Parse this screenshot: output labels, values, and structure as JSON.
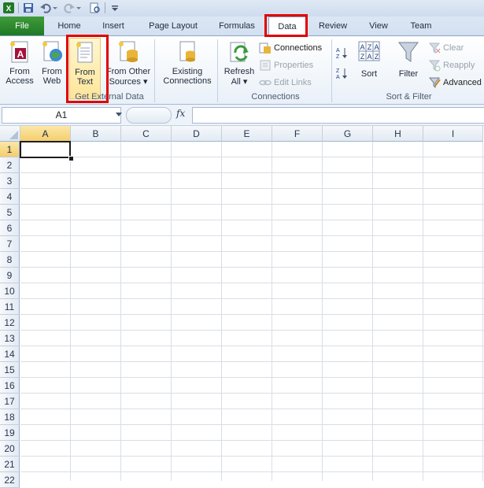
{
  "qat": {
    "icons": [
      "excel-logo-icon",
      "save-icon",
      "undo-icon",
      "redo-icon",
      "print-preview-icon",
      "customize-icon"
    ]
  },
  "tabs": [
    {
      "id": "file",
      "label": "File"
    },
    {
      "id": "home",
      "label": "Home"
    },
    {
      "id": "insert",
      "label": "Insert"
    },
    {
      "id": "page_layout",
      "label": "Page Layout"
    },
    {
      "id": "formulas",
      "label": "Formulas"
    },
    {
      "id": "data",
      "label": "Data"
    },
    {
      "id": "review",
      "label": "Review"
    },
    {
      "id": "view",
      "label": "View"
    },
    {
      "id": "team",
      "label": "Team"
    }
  ],
  "ribbon": {
    "get_external_data": {
      "group_label": "Get External Data",
      "from_access": [
        "From",
        "Access"
      ],
      "from_web": [
        "From",
        "Web"
      ],
      "from_text": [
        "From",
        "Text"
      ],
      "from_other_sources": [
        "From Other",
        "Sources"
      ],
      "existing_connections": [
        "Existing",
        "Connections"
      ]
    },
    "connections": {
      "group_label": "Connections",
      "refresh_all": [
        "Refresh",
        "All"
      ],
      "connections": "Connections",
      "properties": "Properties",
      "edit_links": "Edit Links"
    },
    "sort_filter": {
      "group_label": "Sort & Filter",
      "sort": "Sort",
      "filter": "Filter",
      "clear": "Clear",
      "reapply": "Reapply",
      "advanced": "Advanced"
    }
  },
  "formula_bar": {
    "name_box": "A1",
    "fx_label": "fx",
    "formula": ""
  },
  "grid": {
    "columns": [
      "A",
      "B",
      "C",
      "D",
      "E",
      "F",
      "G",
      "H",
      "I"
    ],
    "rows": [
      "1",
      "2",
      "3",
      "4",
      "5",
      "6",
      "7",
      "8",
      "9",
      "10",
      "11",
      "12",
      "13",
      "14",
      "15",
      "16",
      "17",
      "18",
      "19",
      "20",
      "21",
      "22"
    ],
    "active_cell": "A1"
  }
}
